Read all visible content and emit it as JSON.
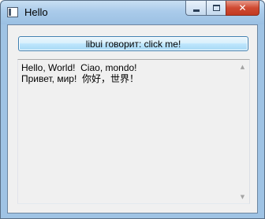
{
  "window": {
    "title": "Hello",
    "icon": "app-window-icon",
    "close_glyph": "✕"
  },
  "button": {
    "label": "libui говорит: click me!"
  },
  "text_area": {
    "lines": [
      "Hello, World!  Ciao, mondo!",
      "Привет, мир!  你好，世界！"
    ]
  },
  "scrollbar": {
    "up_glyph": "▲",
    "down_glyph": "▼"
  },
  "colors": {
    "frame": "#9fc3e4",
    "client_bg": "#f0f0f0",
    "button_border": "#3c7fb1",
    "close_red": "#c23a22"
  }
}
